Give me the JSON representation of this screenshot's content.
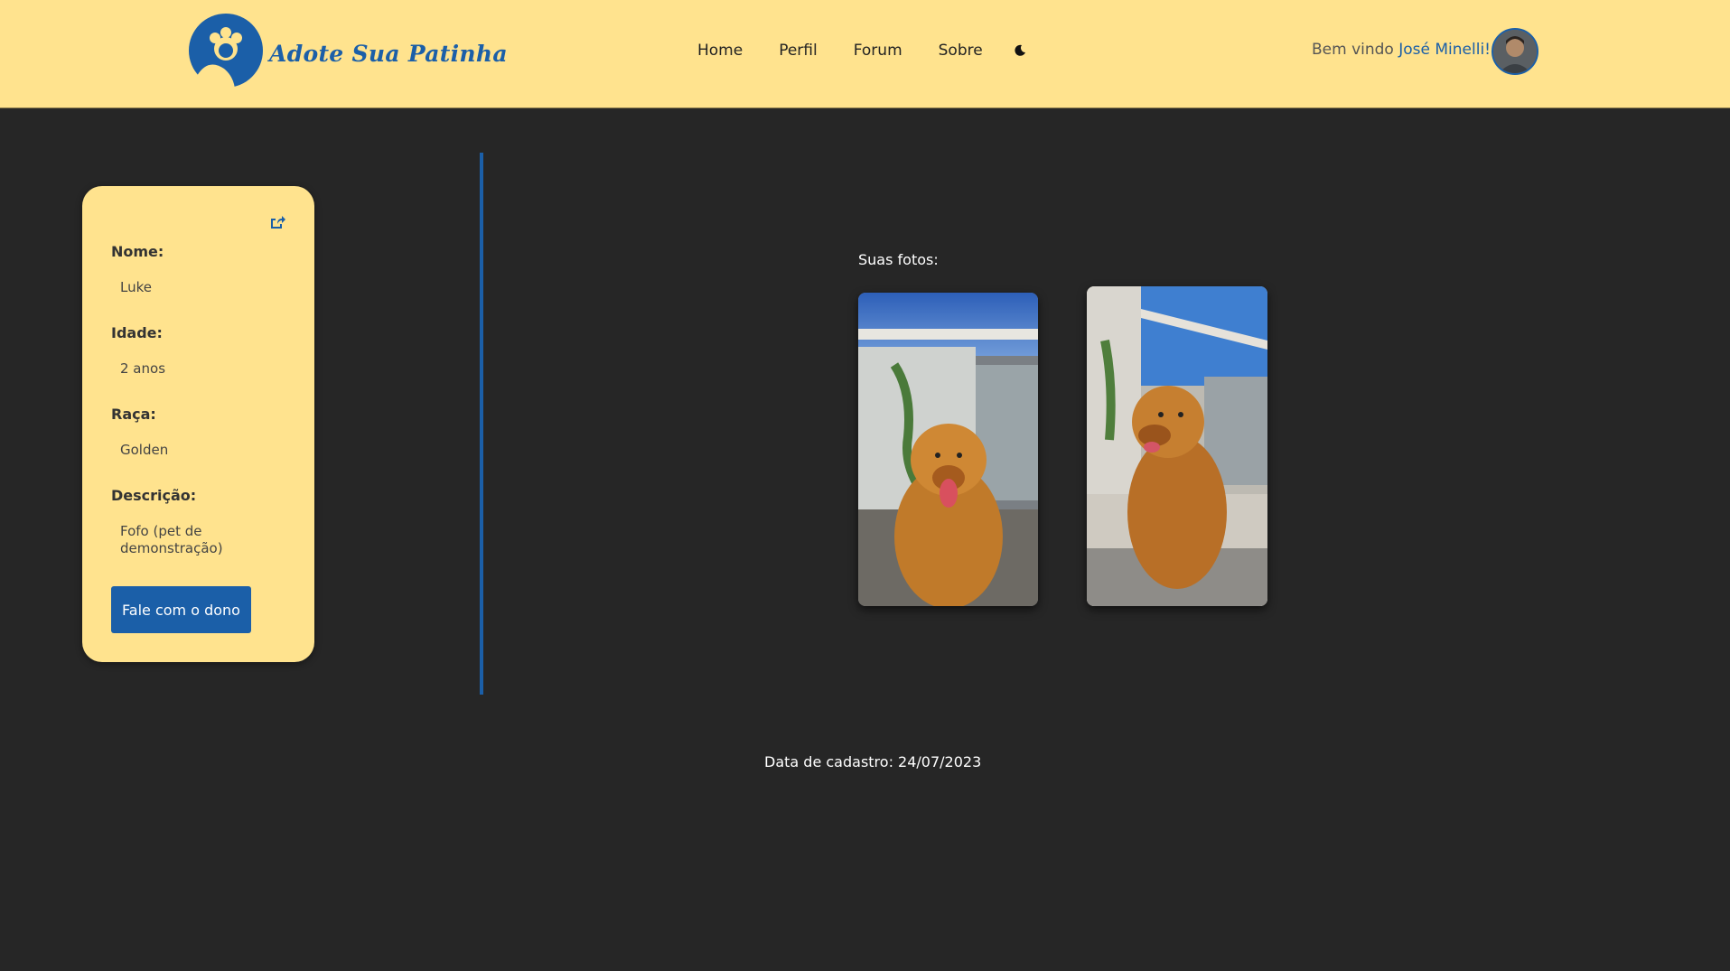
{
  "header": {
    "logo_text": "Adote Sua Patinha",
    "nav": [
      {
        "label": "Home"
      },
      {
        "label": "Perfil"
      },
      {
        "label": "Forum"
      },
      {
        "label": "Sobre"
      }
    ],
    "theme_toggle_icon": "moon-icon",
    "welcome_prefix": "Bem vindo",
    "welcome_user": "José Minelli!",
    "avatar_icon": "user-avatar"
  },
  "pet": {
    "edit_icon": "share-edit-icon",
    "fields": [
      {
        "label": "Nome:",
        "value": "Luke"
      },
      {
        "label": "Idade:",
        "value": "2 anos"
      },
      {
        "label": "Raça:",
        "value": "Golden"
      },
      {
        "label": "Descrição:",
        "value": "Fofo (pet de demonstração)"
      }
    ],
    "contact_button": "Fale com o dono"
  },
  "photos": {
    "title": "Suas fotos:"
  },
  "footer": {
    "date_text": "Data de cadastro: 24/07/2023"
  },
  "colors": {
    "header_bg": "#FFE38E",
    "page_bg": "#262626",
    "accent": "#1B5FA8"
  }
}
